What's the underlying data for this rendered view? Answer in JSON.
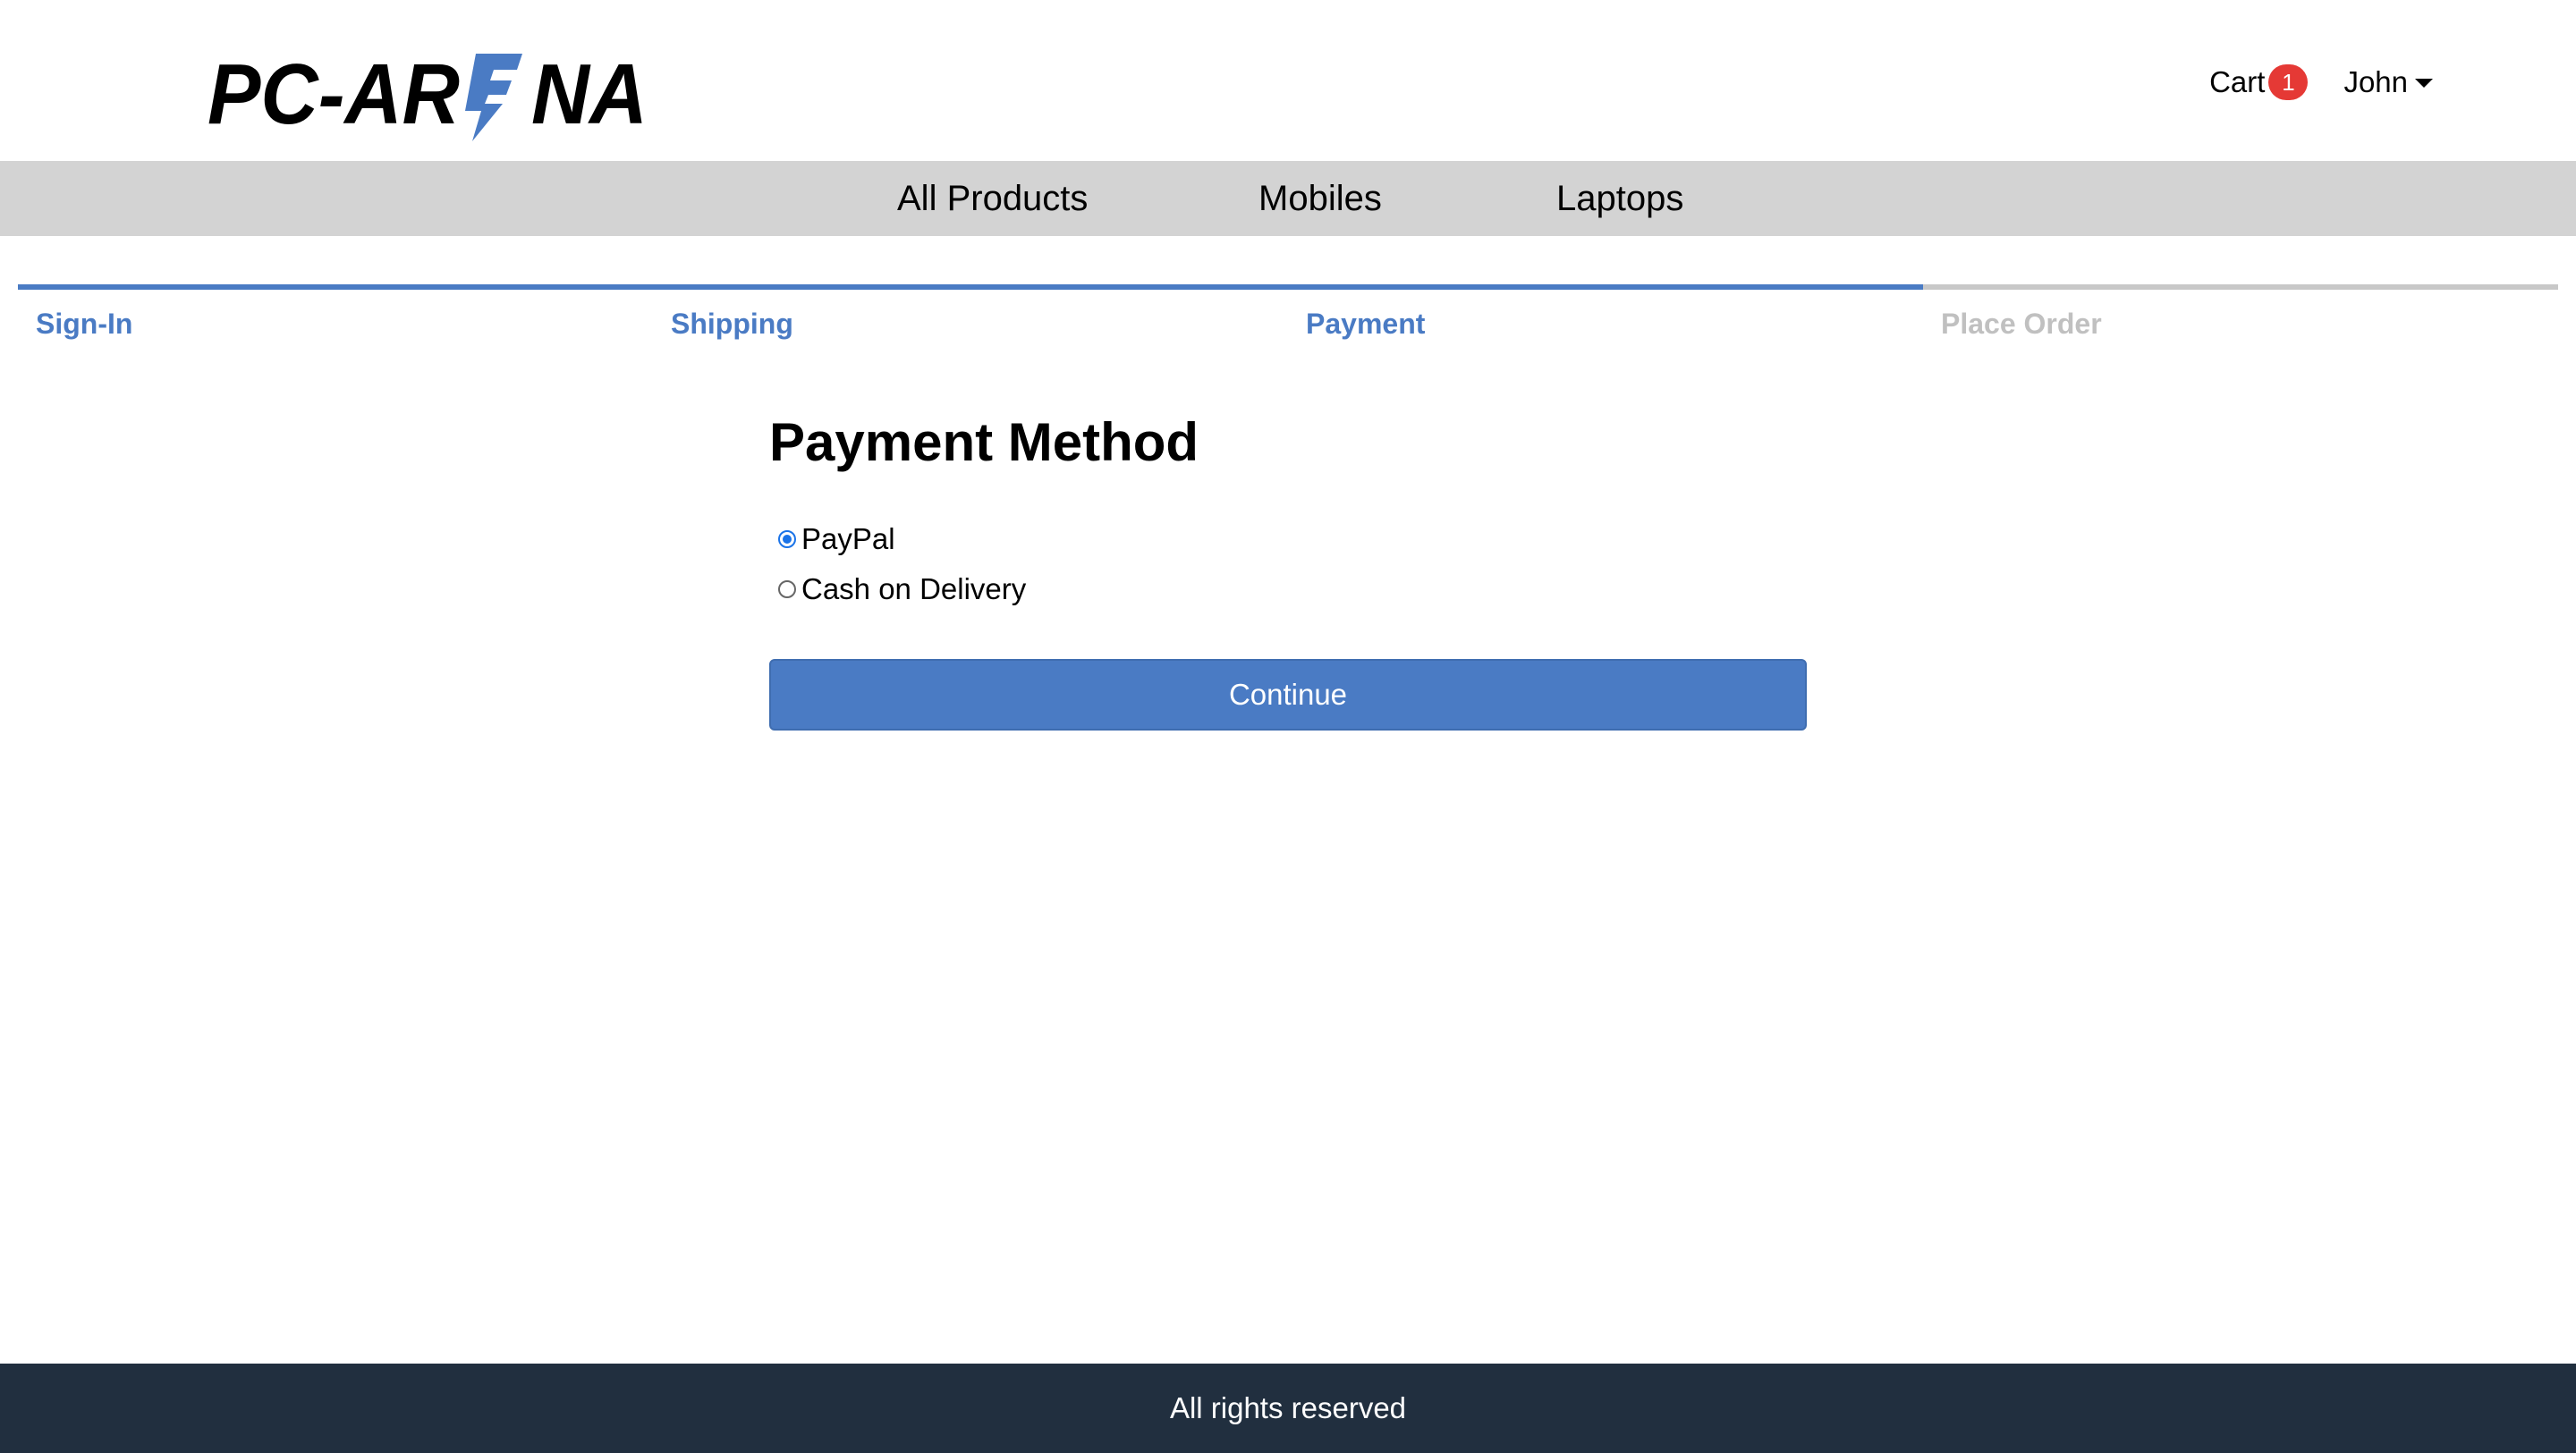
{
  "brand": {
    "logo_text_left": "PC-AR",
    "logo_text_right": "NA",
    "accent_color": "#4a7bc4"
  },
  "header": {
    "cart_label": "Cart",
    "cart_count": "1",
    "user_name": "John"
  },
  "nav": {
    "items": [
      {
        "label": "All Products"
      },
      {
        "label": "Mobiles"
      },
      {
        "label": "Laptops"
      }
    ]
  },
  "checkout_steps": [
    {
      "label": "Sign-In",
      "active": true
    },
    {
      "label": "Shipping",
      "active": true
    },
    {
      "label": "Payment",
      "active": true
    },
    {
      "label": "Place Order",
      "active": false
    }
  ],
  "payment": {
    "title": "Payment Method",
    "options": [
      {
        "label": "PayPal",
        "selected": true
      },
      {
        "label": "Cash on Delivery",
        "selected": false
      }
    ],
    "continue_label": "Continue"
  },
  "footer": {
    "text": "All rights reserved"
  }
}
